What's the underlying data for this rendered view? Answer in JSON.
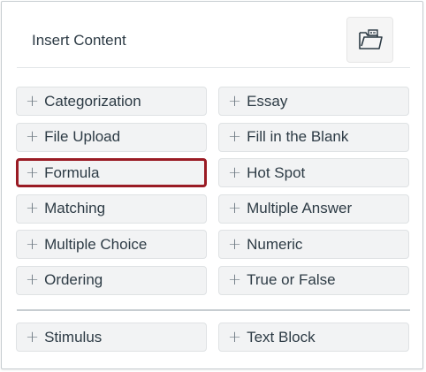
{
  "header": {
    "title": "Insert Content",
    "folder_icon": "folder-icon"
  },
  "content_types": [
    {
      "label": "Categorization",
      "icon": "plus-icon"
    },
    {
      "label": "Essay",
      "icon": "plus-icon"
    },
    {
      "label": "File Upload",
      "icon": "plus-icon"
    },
    {
      "label": "Fill in the Blank",
      "icon": "plus-icon"
    },
    {
      "label": "Formula",
      "icon": "plus-icon",
      "focused": true
    },
    {
      "label": "Hot Spot",
      "icon": "plus-icon"
    },
    {
      "label": "Matching",
      "icon": "plus-icon"
    },
    {
      "label": "Multiple Answer",
      "icon": "plus-icon"
    },
    {
      "label": "Multiple Choice",
      "icon": "plus-icon"
    },
    {
      "label": "Numeric",
      "icon": "plus-icon"
    },
    {
      "label": "Ordering",
      "icon": "plus-icon"
    },
    {
      "label": "True or False",
      "icon": "plus-icon"
    }
  ],
  "other_types": [
    {
      "label": "Stimulus",
      "icon": "plus-icon"
    },
    {
      "label": "Text Block",
      "icon": "plus-icon"
    }
  ],
  "plus_glyph": "+",
  "colors": {
    "focus_border": "#9a1b24",
    "button_bg": "#f2f3f4",
    "text": "#2d3b45"
  }
}
